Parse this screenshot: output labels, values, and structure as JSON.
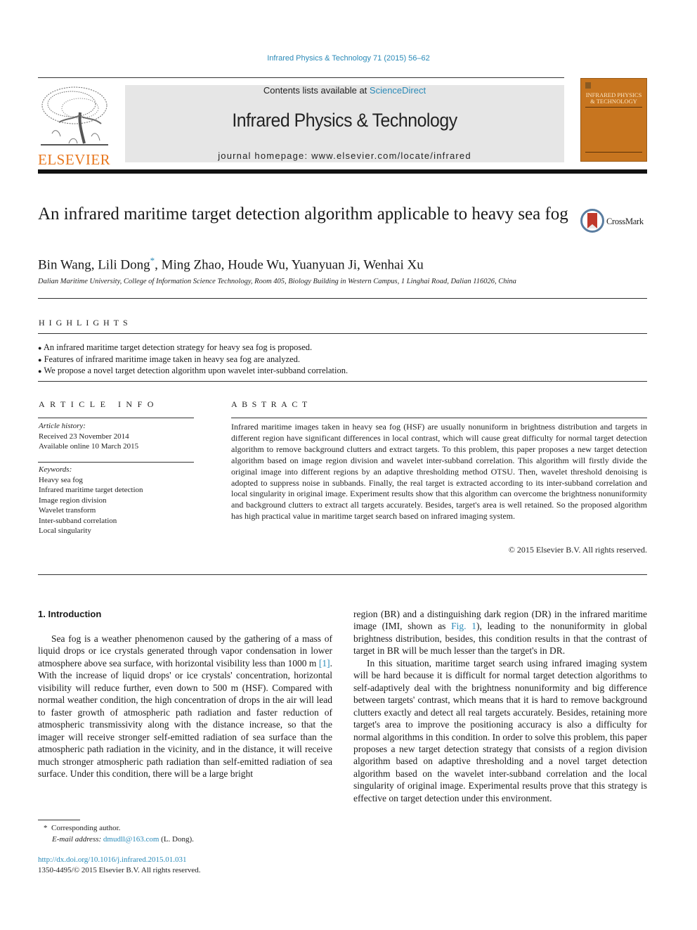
{
  "header": {
    "citation": "Infrared Physics & Technology 71 (2015) 56–62",
    "publisher_logo_text": "ELSEVIER",
    "contents_prefix": "Contents lists available at ",
    "contents_link": "ScienceDirect",
    "journal_name": "Infrared Physics & Technology",
    "homepage": "journal homepage: www.elsevier.com/locate/infrared",
    "cover_title_line1": "INFRARED PHYSICS",
    "cover_title_line2": "& TECHNOLOGY",
    "colors": {
      "link": "#2a8ab8",
      "elsevier_orange": "#e8771e",
      "cover": "#c7751f",
      "banner_bg": "#e6e6e6"
    }
  },
  "article": {
    "title": "An infrared maritime target detection algorithm applicable to heavy sea fog",
    "crossmark_label": "CrossMark",
    "authors": [
      {
        "name": "Bin Wang",
        "mark": ""
      },
      {
        "name": "Lili Dong",
        "mark": "*"
      },
      {
        "name": "Ming Zhao",
        "mark": ""
      },
      {
        "name": "Houde Wu",
        "mark": ""
      },
      {
        "name": "Yuanyuan Ji",
        "mark": ""
      },
      {
        "name": "Wenhai Xu",
        "mark": ""
      }
    ],
    "affiliation": "Dalian Maritime University, College of Information Science Technology, Room 405, Biology Building in Western Campus, 1 Linghai Road, Dalian 116026, China"
  },
  "highlights": {
    "heading": "HIGHLIGHTS",
    "items": [
      "An infrared maritime target detection strategy for heavy sea fog is proposed.",
      "Features of infrared maritime image taken in heavy sea fog are analyzed.",
      "We propose a novel target detection algorithm upon wavelet inter-subband correlation."
    ]
  },
  "article_info": {
    "heading": "ARTICLE INFO",
    "history_label": "Article history:",
    "received": "Received 23 November 2014",
    "available": "Available online 10 March 2015",
    "keywords_label": "Keywords:",
    "keywords": [
      "Heavy sea fog",
      "Infrared maritime target detection",
      "Image region division",
      "Wavelet transform",
      "Inter-subband correlation",
      "Local singularity"
    ]
  },
  "abstract": {
    "heading": "ABSTRACT",
    "text": "Infrared maritime images taken in heavy sea fog (HSF) are usually nonuniform in brightness distribution and targets in different region have significant differences in local contrast, which will cause great difficulty for normal target detection algorithm to remove background clutters and extract targets. To this problem, this paper proposes a new target detection algorithm based on image region division and wavelet inter-subband correlation. This algorithm will firstly divide the original image into different regions by an adaptive thresholding method OTSU. Then, wavelet threshold denoising is adopted to suppress noise in subbands. Finally, the real target is extracted according to its inter-subband correlation and local singularity in original image. Experiment results show that this algorithm can overcome the brightness nonuniformity and background clutters to extract all targets accurately. Besides, target's area is well retained. So the proposed algorithm has high practical value in maritime target search based on infrared imaging system.",
    "copyright": "© 2015 Elsevier B.V. All rights reserved."
  },
  "introduction": {
    "heading": "1. Introduction",
    "p1_a": "Sea fog is a weather phenomenon caused by the gathering of a mass of liquid drops or ice crystals generated through vapor condensation in lower atmosphere above sea surface, with horizontal visibility less than 1000 m ",
    "p1_ref": "[1]",
    "p1_b": ". With the increase of liquid drops' or ice crystals' concentration, horizontal visibility will reduce further, even down to 500 m (HSF). Compared with normal weather condition, the high concentration of drops in the air will lead to faster growth of atmospheric path radiation and faster reduction of atmospheric transmissivity along with the distance increase, so that the imager will receive stronger self-emitted radiation of sea surface than the atmospheric path radiation in the vicinity, and in the distance, it will receive much stronger atmospheric path radiation than self-emitted radiation of sea surface. Under this condition, there will be a large bright",
    "p1_c": "region (BR) and a distinguishing dark region (DR) in the infrared maritime image (IMI, shown as ",
    "p1_fig": "Fig. 1",
    "p1_d": "), leading to the nonuniformity in global brightness distribution, besides, this condition results in that the contrast of target in BR will be much lesser than the target's in DR.",
    "p2": "In this situation, maritime target search using infrared imaging system will be hard because it is difficult for normal target detection algorithms to self-adaptively deal with the brightness nonuniformity and big difference between targets' contrast, which means that it is hard to remove background clutters exactly and detect all real targets accurately. Besides, retaining more target's area to improve the positioning accuracy is also a difficulty for normal algorithms in this condition. In order to solve this problem, this paper proposes a new target detection strategy that consists of a region division algorithm based on adaptive thresholding and a novel target detection algorithm based on the wavelet inter-subband correlation and the local singularity of original image. Experimental results prove that this strategy is effective on target detection under this environment."
  },
  "footnotes": {
    "corresponding_mark": "*",
    "corresponding": "Corresponding author.",
    "email_label": "E-mail address:",
    "email": "dmudll@163.com",
    "email_suffix": " (L. Dong).",
    "doi": "http://dx.doi.org/10.1016/j.infrared.2015.01.031",
    "issn_line": "1350-4495/© 2015 Elsevier B.V. All rights reserved."
  }
}
